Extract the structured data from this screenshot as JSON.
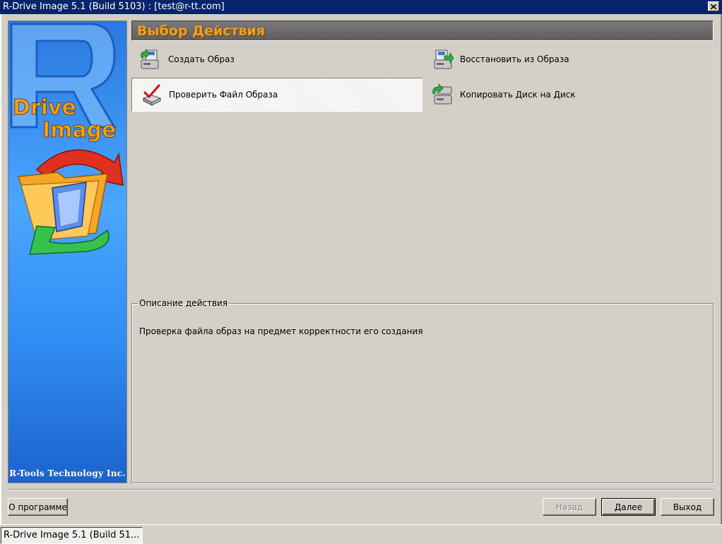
{
  "window": {
    "title": "R-Drive Image 5.1 (Build 5103) : [test@r-tt.com]"
  },
  "sidebar": {
    "logo_letter": "R",
    "logo_line1": "Drive",
    "logo_line2": "Image",
    "company": "R-Tools Technology Inc."
  },
  "header": {
    "title": "Выбор Действия"
  },
  "actions": [
    {
      "label": "Создать Образ",
      "icon": "create-image-icon"
    },
    {
      "label": "Восстановить из Образа",
      "icon": "restore-image-icon"
    },
    {
      "label": "Проверить Файл Образа",
      "icon": "check-image-icon",
      "selected": true
    },
    {
      "label": "Копировать Диск на Диск",
      "icon": "copy-disk-icon"
    }
  ],
  "description": {
    "legend": "Описание действия",
    "text": "Проверка файла образ на предмет корректности его создания"
  },
  "buttons": {
    "about": "О программе",
    "back": "Назад",
    "next": "Далее",
    "exit": "Выход"
  },
  "taskbar": {
    "task_label": "R-Drive Image 5.1 (Build 51..."
  },
  "colors": {
    "titlebar": "#0a246a",
    "header_text": "#f0a020",
    "sidebar_blue": "#2f8cf2"
  }
}
